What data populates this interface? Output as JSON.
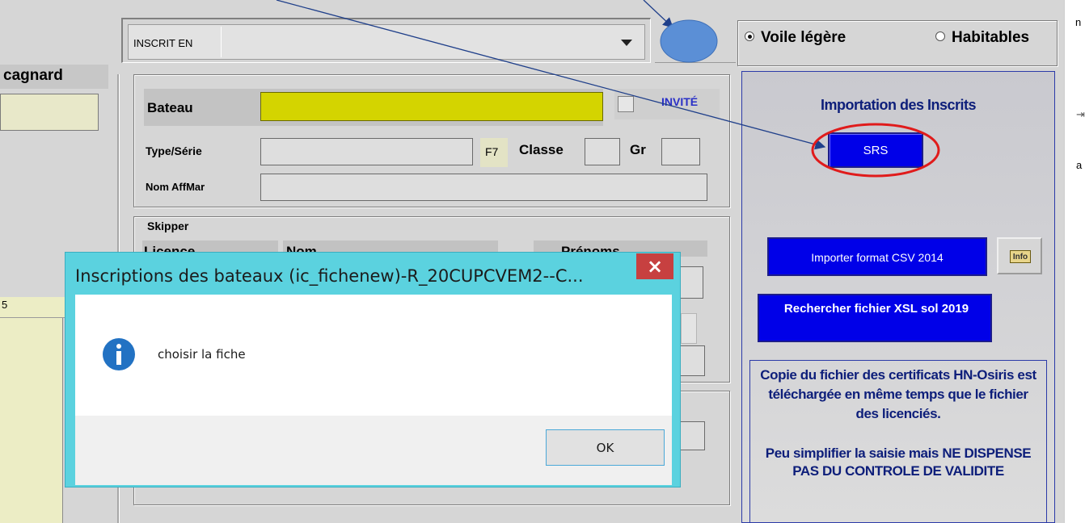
{
  "left_panel": {
    "label": "cagnard",
    "side_marker": "5"
  },
  "inscrit": {
    "label": "INSCRIT EN",
    "value": ""
  },
  "category": {
    "options": [
      "Voile légère",
      "Habitables"
    ],
    "selected": "Voile légère"
  },
  "boat_form": {
    "bateau_label": "Bateau",
    "bateau_value": "",
    "invite_label": "INVITÉ",
    "type_label": "Type/Série",
    "f7_label": "F7",
    "classe_label": "Classe",
    "gr_label": "Gr",
    "nom_affmar_label": "Nom AffMar",
    "skipper_title": "Skipper",
    "licence_label": "Licence",
    "nom_label": "Nom",
    "prenoms_label": "Prénoms"
  },
  "import_panel": {
    "title": "Importation des  Inscrits",
    "srs_label": "SRS",
    "csv_button": "Importer format CSV 2014",
    "info_button": "Info",
    "xsl_button": "Rechercher fichier XSL sol 2019",
    "info_text_1": "Copie du fichier des certificats HN-Osiris est téléchargée en même temps que le fichier des licenciés.",
    "info_text_2": "Peu simplifier la saisie mais NE  DISPENSE  PAS  DU CONTROLE DE VALIDITE"
  },
  "dialog": {
    "title": "Inscriptions des bateaux (ic_fichenew)-R_20CUPCVEM2--C...",
    "close": "×",
    "message": "choisir la fiche",
    "ok": "OK"
  },
  "edge_fragments": [
    "n",
    "a"
  ],
  "colors": {
    "bateau_field": "#d4d400",
    "srs_button": "#0000e8",
    "dialog_border": "#5bd2df",
    "annotation_circle": "#5b8fd6",
    "annotation_ellipse": "#e01b1b",
    "arrow": "#1f3f8a"
  }
}
